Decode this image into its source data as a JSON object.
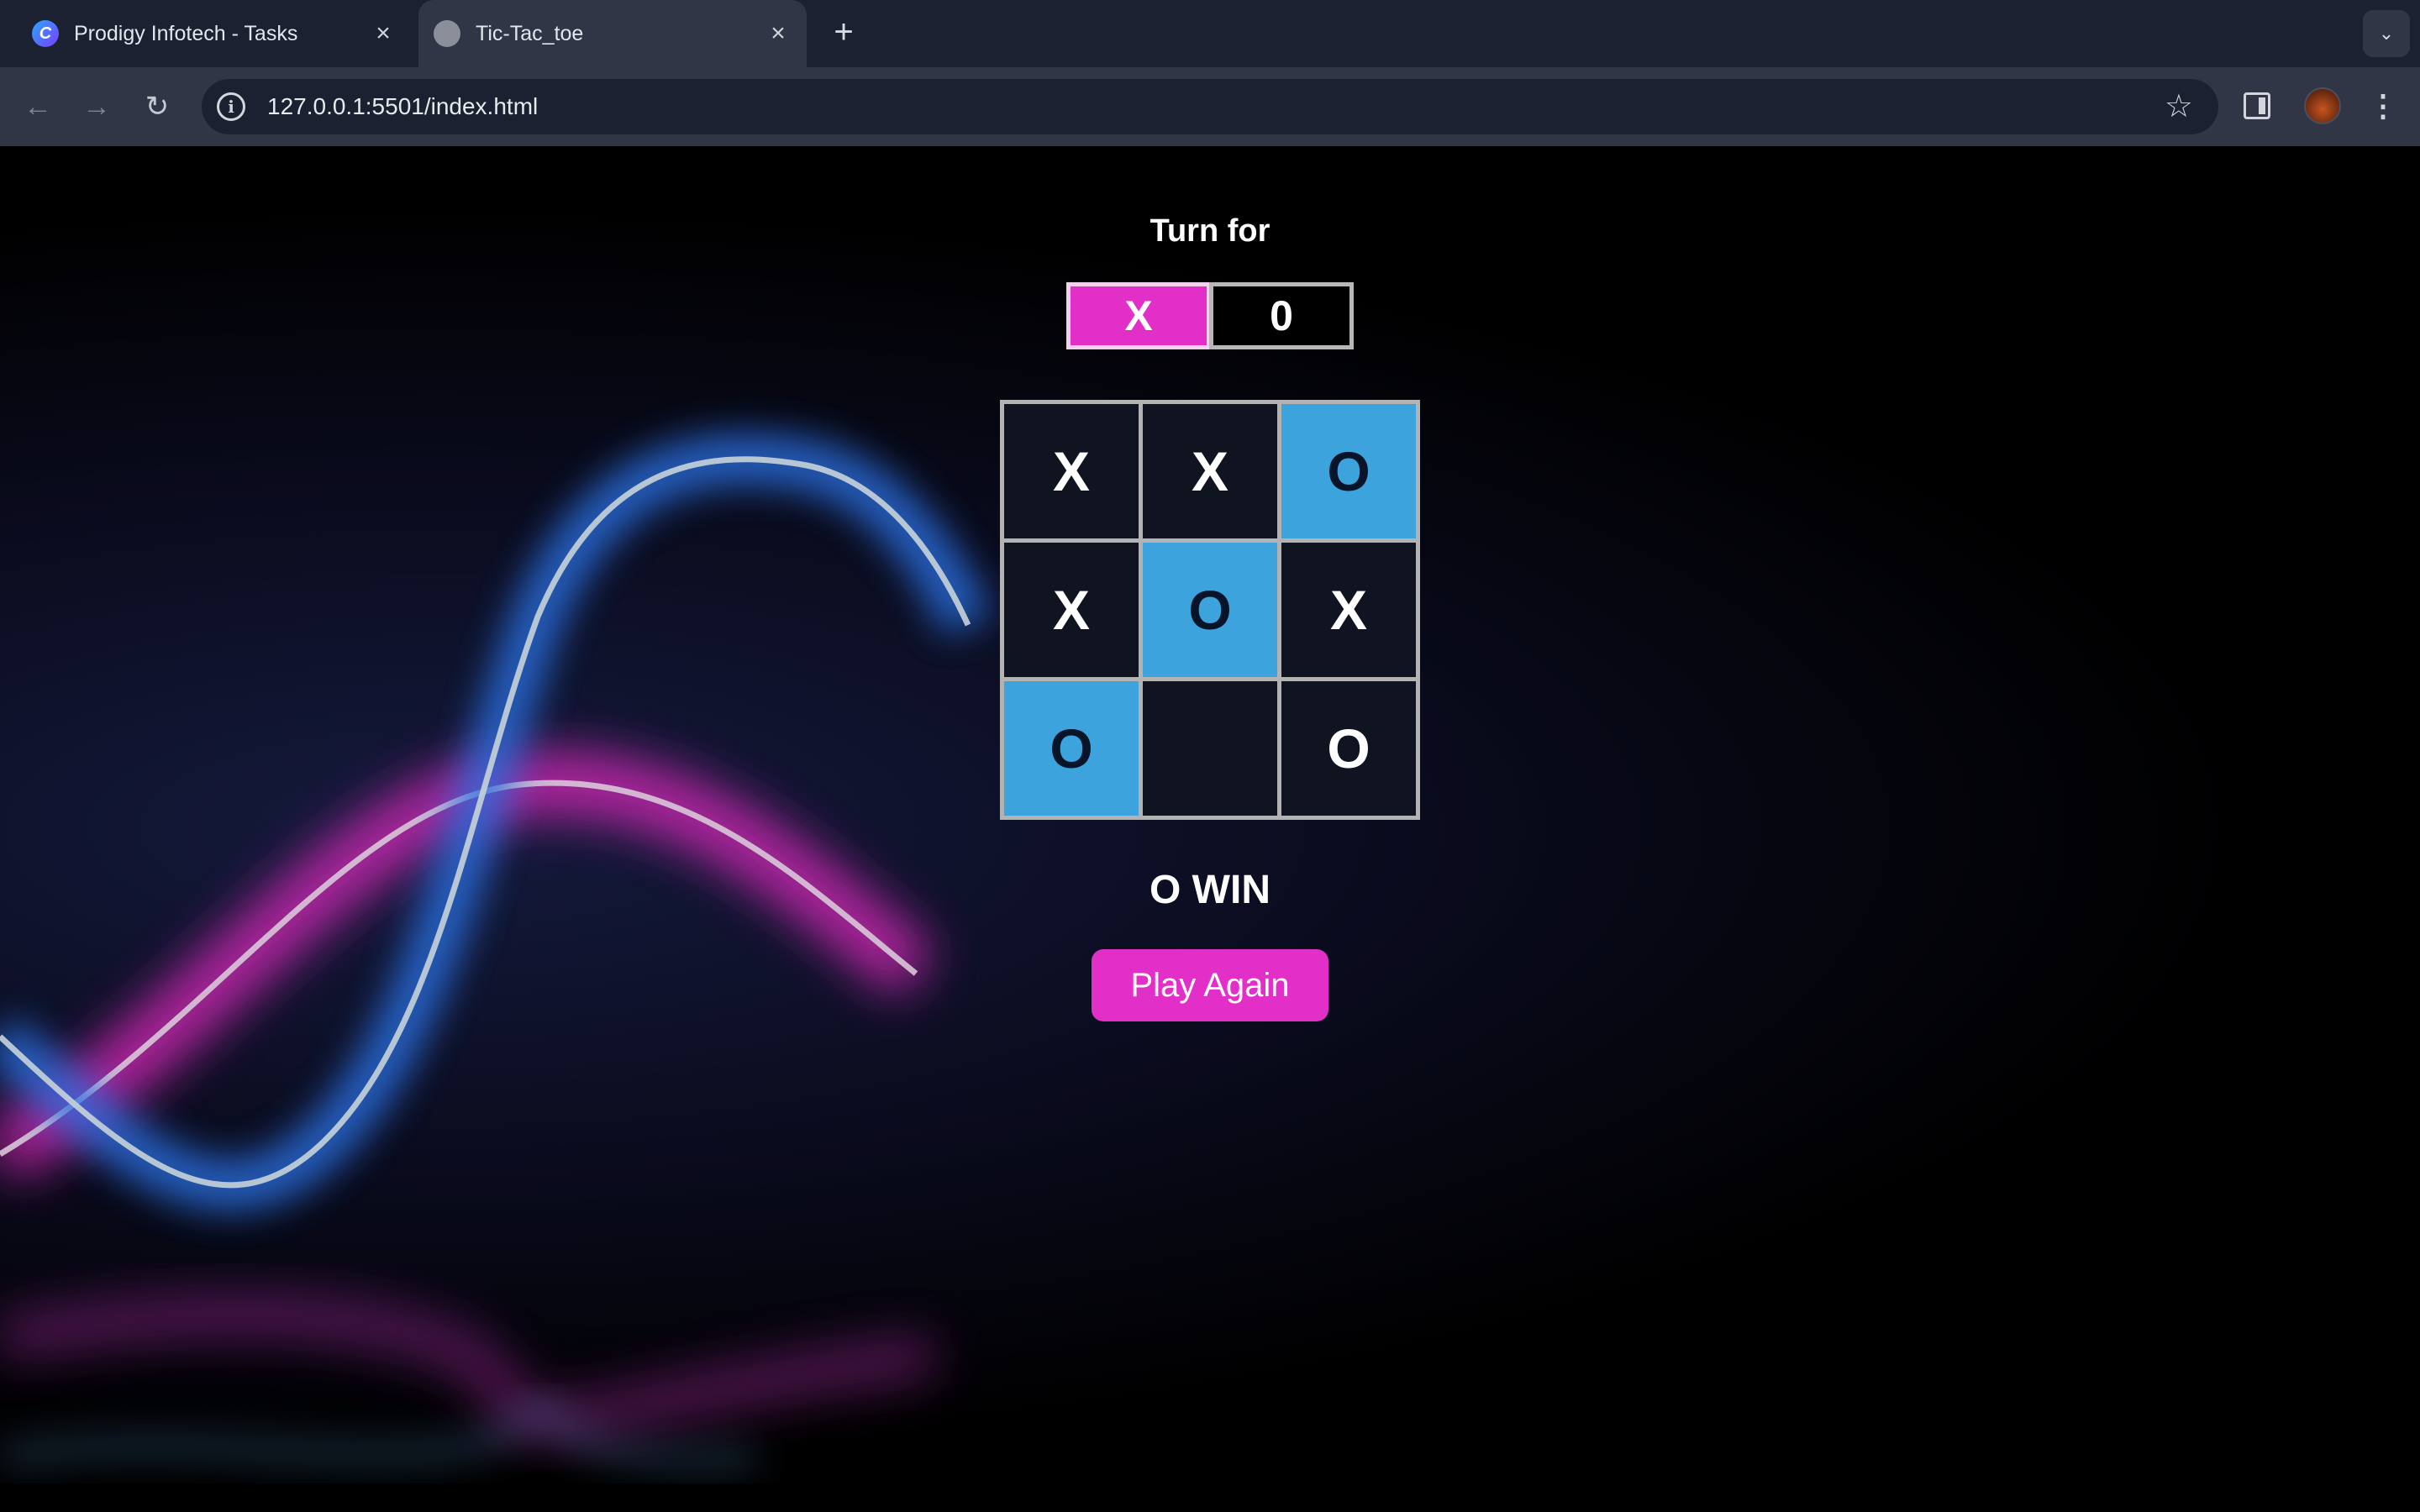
{
  "browser": {
    "tabs": [
      {
        "title": "Prodigy Infotech - Tasks",
        "active": false,
        "icon": "canva-icon"
      },
      {
        "title": "Tic-Tac_toe",
        "active": true,
        "icon": "globe-icon"
      }
    ],
    "url": "127.0.0.1:5501/index.html"
  },
  "game": {
    "turn_label": "Turn for",
    "turn_x": "X",
    "turn_o": "0",
    "board": [
      "X",
      "X",
      "O",
      "X",
      "O",
      "X",
      "O",
      "",
      "O"
    ],
    "winning_cells": [
      2,
      4,
      6
    ],
    "result": "O WIN",
    "play_again": "Play Again"
  },
  "colors": {
    "accent": "#e22fc8",
    "win_cell": "#3da3dc",
    "background": "#000000"
  }
}
